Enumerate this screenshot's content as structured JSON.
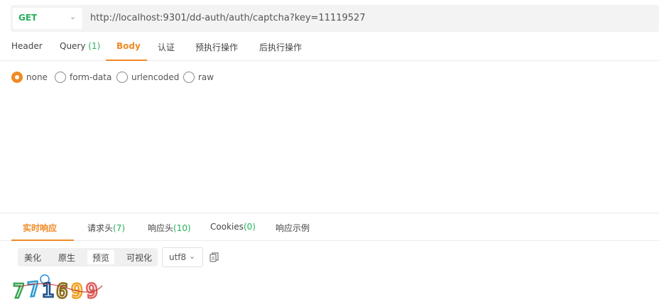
{
  "request": {
    "method": "GET",
    "url": "http://localhost:9301/dd-auth/auth/captcha?key=11119527"
  },
  "request_tabs": [
    {
      "label": "Header",
      "count": ""
    },
    {
      "label": "Query ",
      "count": "(1)"
    },
    {
      "label": "Body",
      "count": ""
    },
    {
      "label": "认证",
      "count": ""
    },
    {
      "label": "预执行操作",
      "count": ""
    },
    {
      "label": "后执行操作",
      "count": ""
    }
  ],
  "active_request_tab": "Body",
  "body_types": [
    "none",
    "form-data",
    "urlencoded",
    "raw"
  ],
  "selected_body_type": "none",
  "response_tabs": [
    {
      "label": "实时响应",
      "count": ""
    },
    {
      "label": "请求头",
      "count": "(7)"
    },
    {
      "label": "响应头",
      "count": "(10)"
    },
    {
      "label": "Cookies",
      "count": "(0)"
    },
    {
      "label": "响应示例",
      "count": ""
    }
  ],
  "active_response_tab": "实时响应",
  "view_modes": [
    "美化",
    "原生",
    "预览",
    "可视化"
  ],
  "active_view_mode": "预览",
  "encoding": "utf8",
  "captcha_text": "771699",
  "colors": {
    "accent": "#f08a24",
    "method_get": "#26b05c",
    "count": "#26b05c"
  },
  "icons": {
    "method_dropdown": "chevron-down-icon",
    "encoding_dropdown": "chevron-down-icon",
    "copy": "copy-icon"
  }
}
